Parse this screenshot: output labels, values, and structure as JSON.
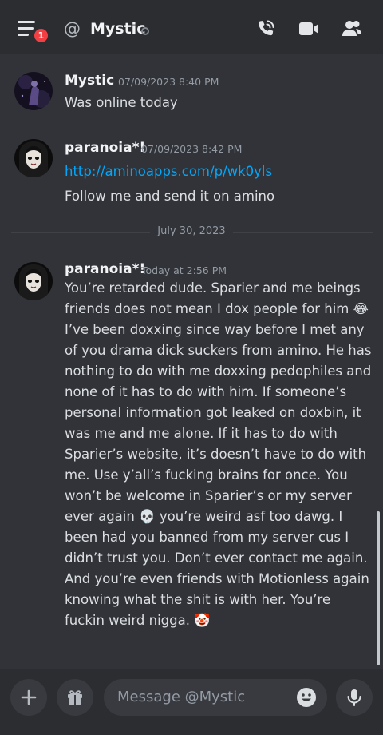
{
  "header": {
    "badge_count": "1",
    "at_symbol": "@",
    "title": "Mystic",
    "icons": [
      "menu-icon",
      "at-icon",
      "status-offline-icon",
      "phone-call-icon",
      "video-camera-icon",
      "members-icon"
    ]
  },
  "messages": [
    {
      "author": "Mystic",
      "timestamp": "07/09/2023 8:40 PM",
      "lines": [
        "Was online today"
      ]
    },
    {
      "author": "paranoia*!",
      "timestamp": "07/09/2023 8:42 PM",
      "link": "http://aminoapps.com/p/wk0yls",
      "lines": [
        "Follow me and send it on amino"
      ]
    },
    {
      "author": "paranoia*!",
      "timestamp": "Today at 2:56 PM",
      "lines": [
        "You’re retarded dude. Sparier and me beings",
        "friends does not mean I dox people for him 😂",
        "I’ve been doxxing since way before I met any",
        "of you drama dick suckers from amino. He has",
        "nothing to do with me doxxing pedophiles and",
        "none of it has to do with him. If someone’s",
        "personal information got leaked on doxbin, it",
        "was me and me alone. If it has to do with",
        "Sparier’s website, it’s doesn’t have to do with",
        "me. Use y’all’s fucking brains for once. You",
        "won’t be welcome in Sparier’s or my server",
        "ever again 💀 you’re weird asf too dawg. I",
        "been had you banned from my server cus I",
        "didn’t trust you. Don’t ever contact me again.",
        "And you’re even friends with Motionless again",
        "knowing what the shit is with her. You’re",
        "fuckin weird nigga. 🤡"
      ]
    }
  ],
  "date_divider": "July 30, 2023",
  "composer": {
    "placeholder": "Message @Mystic",
    "icons": [
      "plus-icon",
      "gift-icon",
      "emoji-icon",
      "microphone-icon"
    ]
  },
  "colors": {
    "background": "#313338",
    "header": "#2b2d31",
    "link": "#00a8fc",
    "badge": "#f23f43",
    "timestamp": "#949ba4"
  }
}
